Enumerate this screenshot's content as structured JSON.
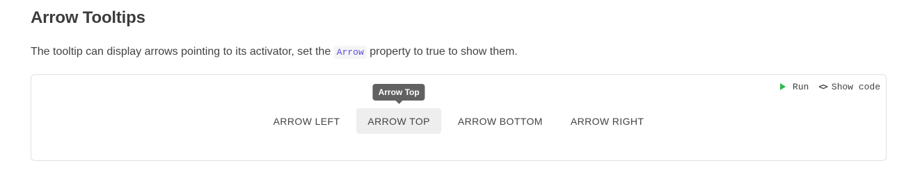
{
  "section": {
    "title": "Arrow Tooltips",
    "description_before": "The tooltip can display arrows pointing to its activator, set the ",
    "description_code": "Arrow",
    "description_after": " property to true to show them."
  },
  "toolbar": {
    "run_label": "Run",
    "run_icon": "play-icon",
    "show_code_label": "Show code",
    "show_code_icon": "code-brackets-icon"
  },
  "demo": {
    "buttons": [
      {
        "label": "Arrow Left"
      },
      {
        "label": "Arrow Top",
        "hovered": true
      },
      {
        "label": "Arrow Bottom"
      },
      {
        "label": "Arrow Right"
      }
    ],
    "tooltip_text": "Arrow Top"
  },
  "colors": {
    "accent_code": "#594ae2",
    "run_icon": "#2fb84d",
    "tooltip_bg": "#616161"
  }
}
